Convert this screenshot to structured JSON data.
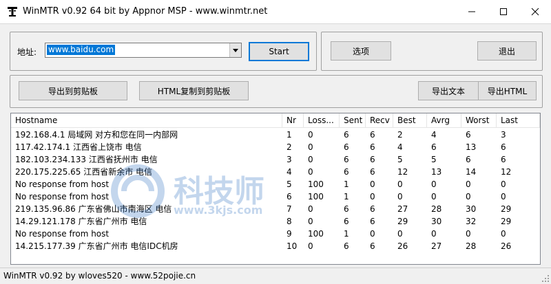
{
  "window": {
    "title": "WinMTR v0.92 64 bit by Appnor MSP - www.winmtr.net",
    "controls": {
      "minimize": "—",
      "maximize": "☐",
      "close": "✕"
    }
  },
  "toolbar": {
    "address_label": "地址:",
    "address_value": "www.baidu.com",
    "start_label": "Start",
    "options_label": "选项",
    "exit_label": "退出",
    "export_clipboard_label": "导出到剪贴板",
    "html_clipboard_label": "HTML复制到剪贴板",
    "export_text_label": "导出文本",
    "export_html_label": "导出HTML"
  },
  "table": {
    "columns": [
      "Hostname",
      "Nr",
      "Loss...",
      "Sent",
      "Recv",
      "Best",
      "Avrg",
      "Worst",
      "Last"
    ],
    "rows": [
      [
        "192.168.4.1 局域网 对方和您在同一内部网",
        "1",
        "0",
        "6",
        "6",
        "2",
        "4",
        "6",
        "3"
      ],
      [
        "117.42.174.1 江西省上饶市 电信",
        "2",
        "0",
        "6",
        "6",
        "4",
        "6",
        "13",
        "6"
      ],
      [
        "182.103.234.133 江西省抚州市 电信",
        "3",
        "0",
        "6",
        "6",
        "5",
        "5",
        "6",
        "6"
      ],
      [
        "220.175.225.65 江西省新余市 电信",
        "4",
        "0",
        "6",
        "6",
        "12",
        "13",
        "14",
        "12"
      ],
      [
        "No response from host",
        "5",
        "100",
        "1",
        "0",
        "0",
        "0",
        "0",
        "0"
      ],
      [
        "No response from host",
        "6",
        "100",
        "1",
        "0",
        "0",
        "0",
        "0",
        "0"
      ],
      [
        "219.135.96.86 广东省佛山市南海区 电信",
        "7",
        "0",
        "6",
        "6",
        "27",
        "28",
        "30",
        "29"
      ],
      [
        "14.29.121.178 广东省广州市 电信",
        "8",
        "0",
        "6",
        "6",
        "29",
        "30",
        "32",
        "29"
      ],
      [
        "No response from host",
        "9",
        "100",
        "1",
        "0",
        "0",
        "0",
        "0",
        "0"
      ],
      [
        "14.215.177.39 广东省广州市 电信IDC机房",
        "10",
        "0",
        "6",
        "6",
        "26",
        "27",
        "28",
        "26"
      ]
    ]
  },
  "watermark": {
    "title": "科技师",
    "url": "www.3kjs.com"
  },
  "status": {
    "text": "WinMTR v0.92 by wloves520 - www.52pojie.cn"
  }
}
